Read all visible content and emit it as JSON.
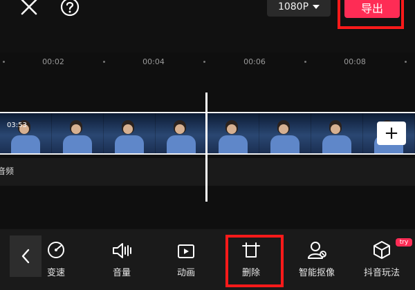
{
  "header": {
    "resolution": "1080P",
    "export_label": "导出"
  },
  "timeline": {
    "ticks": [
      "00:02",
      "00:04",
      "00:06",
      "00:08"
    ],
    "clip_duration": "03:53",
    "audio_label": "音频",
    "add_label": "+"
  },
  "toolbar": {
    "tools": [
      {
        "label": "变速",
        "icon": "speed-icon"
      },
      {
        "label": "音量",
        "icon": "volume-icon"
      },
      {
        "label": "动画",
        "icon": "animation-icon"
      },
      {
        "label": "删除",
        "icon": "delete-icon"
      },
      {
        "label": "智能抠像",
        "icon": "smart-cutout-icon"
      },
      {
        "label": "抖音玩法",
        "icon": "douyin-play-icon"
      }
    ],
    "try_badge": "try"
  },
  "colors": {
    "accent": "#fe2c55",
    "highlight": "#ff1a1a",
    "background": "#111111"
  }
}
